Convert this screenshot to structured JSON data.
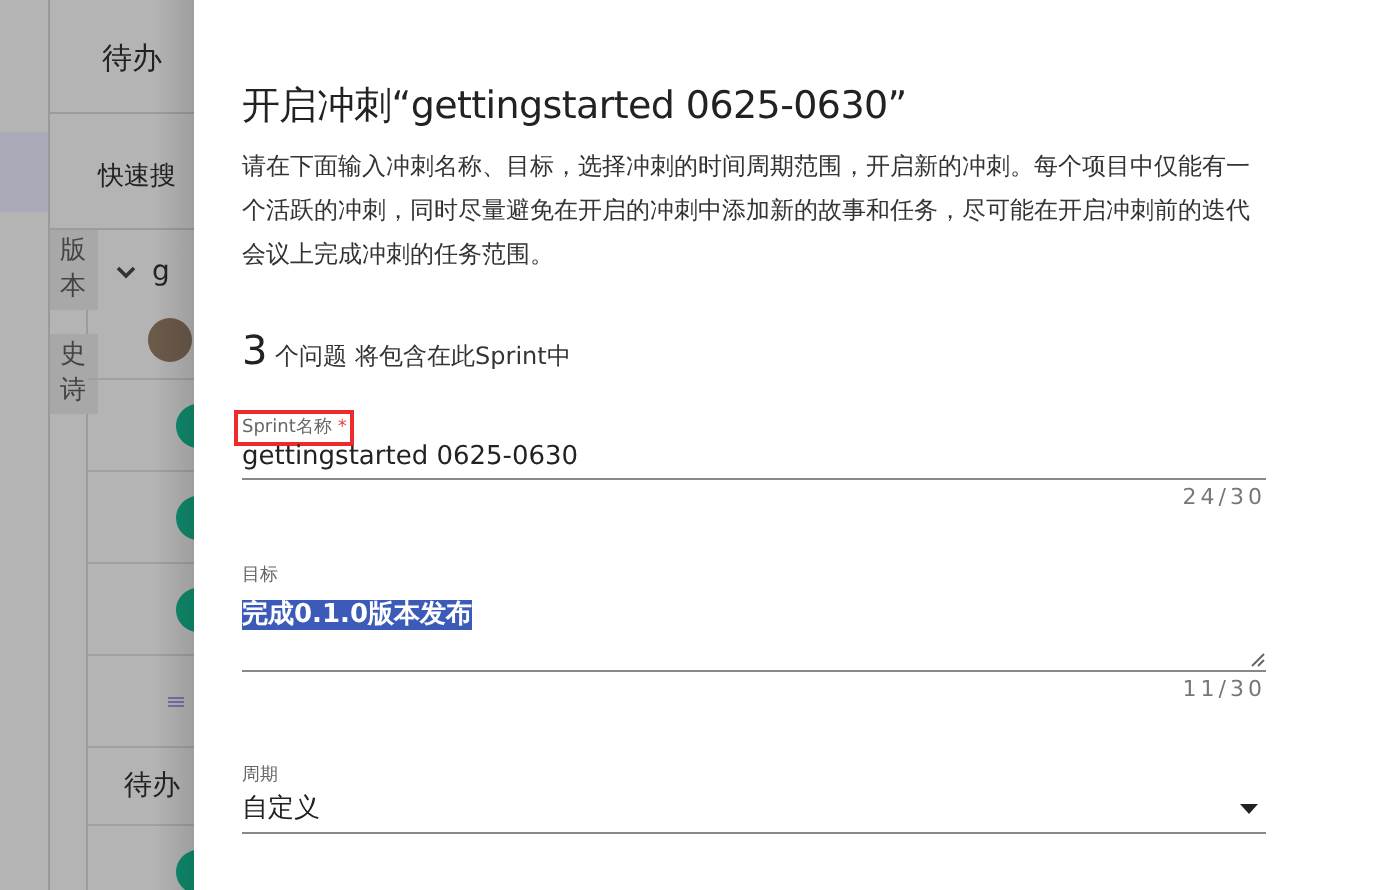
{
  "background": {
    "header_title": "待办",
    "search_label": "快速搜",
    "side_tabs": [
      {
        "label": "版本",
        "selected": false
      },
      {
        "label": "史诗",
        "selected": false
      }
    ],
    "list": [
      {
        "kind": "group",
        "text": "g"
      },
      {
        "kind": "avatar"
      },
      {
        "kind": "issue"
      },
      {
        "kind": "issue"
      },
      {
        "kind": "issue"
      },
      {
        "kind": "menu"
      },
      {
        "kind": "heading",
        "text": "待办"
      },
      {
        "kind": "issue"
      }
    ]
  },
  "dialog": {
    "title": "开启冲刺“gettingstarted 0625-0630”",
    "description": "请在下面输入冲刺名称、目标，选择冲刺的时间周期范围，开启新的冲刺。每个项目中仅能有一个活跃的冲刺，同时尽量避免在开启的冲刺中添加新的故事和任务，尽可能在开启冲刺前的迭代会议上完成冲刺的任务范围。",
    "issue_count": "3",
    "issue_count_text": "个问题 将包含在此Sprint中",
    "fields": [
      {
        "kind": "input",
        "label": "Sprint名称",
        "required_mark": "*",
        "highlighted": true,
        "value": "gettingstarted 0625-0630",
        "counter": "24/30"
      },
      {
        "kind": "textarea",
        "label": "目标",
        "highlighted": false,
        "value": "完成0.1.0版本发布",
        "value_selected": true,
        "counter": "11/30"
      },
      {
        "kind": "select",
        "label": "周期",
        "highlighted": false,
        "value": "自定义"
      }
    ]
  }
}
